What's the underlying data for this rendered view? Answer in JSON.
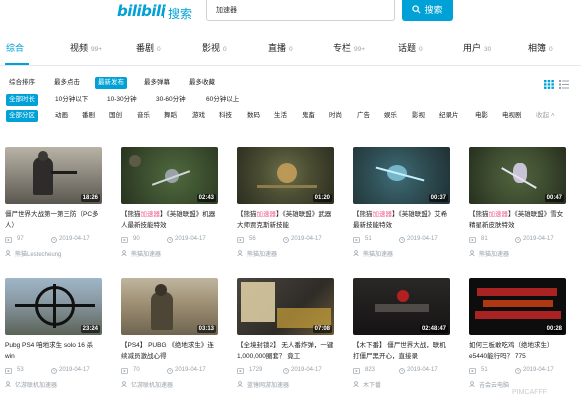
{
  "header": {
    "logo": "bilibili",
    "logo_sub": "搜索",
    "search_value": "加速器",
    "search_button": "搜索"
  },
  "tabs": [
    {
      "label": "综合",
      "count": ""
    },
    {
      "label": "视频",
      "count": "99+"
    },
    {
      "label": "番剧",
      "count": "0"
    },
    {
      "label": "影视",
      "count": "0"
    },
    {
      "label": "直播",
      "count": "0"
    },
    {
      "label": "专栏",
      "count": "99+"
    },
    {
      "label": "话题",
      "count": "0"
    },
    {
      "label": "用户",
      "count": "30"
    },
    {
      "label": "相簿",
      "count": "0"
    }
  ],
  "sort_options": [
    "综合排序",
    "最多点击",
    "最新发布",
    "最多弹幕",
    "最多收藏"
  ],
  "sort_selected": "最新发布",
  "duration_options": [
    "全部时长",
    "10分钟以下",
    "10-30分钟",
    "30-60分钟",
    "60分钟以上"
  ],
  "duration_selected": "全部时长",
  "zone_options": [
    "全部分区",
    "动画",
    "番剧",
    "国创",
    "音乐",
    "舞蹈",
    "游戏",
    "科技",
    "数码",
    "生活",
    "鬼畜",
    "时尚",
    "广告",
    "娱乐",
    "影视",
    "纪录片",
    "电影",
    "电视剧"
  ],
  "zone_selected": "全部分区",
  "zone_collapse": "收起",
  "videos": [
    {
      "duration": "18:26",
      "title_pre": "僵尸世界大战第一第三防（PC多人）",
      "title_hl": "",
      "title_post": "",
      "views": "97",
      "date": "2019-04-17",
      "uploader": "熊猫Lestecheung"
    },
    {
      "duration": "02:43",
      "title_pre": "【熊猫",
      "title_hl": "加速器",
      "title_post": "】《英雄联盟》机器人最新技能特效",
      "views": "90",
      "date": "2019-04-17",
      "uploader": "熊猫加速器"
    },
    {
      "duration": "01:20",
      "title_pre": "【熊猫",
      "title_hl": "加速器",
      "title_post": "】《英雄联盟》武器大师贾克斯新技能",
      "views": "56",
      "date": "2019-04-17",
      "uploader": "熊猫加速器"
    },
    {
      "duration": "00:37",
      "title_pre": "【熊猫",
      "title_hl": "加速器",
      "title_post": "】《英雄联盟》艾希最新技能特效",
      "views": "51",
      "date": "2019-04-17",
      "uploader": "熊猫加速器"
    },
    {
      "duration": "00:47",
      "title_pre": "【熊猫",
      "title_hl": "加速器",
      "title_post": "】《英雄联盟》雪女精星新皮肤特效",
      "views": "81",
      "date": "2019-04-17",
      "uploader": "熊猫加速器"
    },
    {
      "duration": "23:24",
      "title_pre": "Pubg PS4 咱地求生 solo 16 杀win",
      "title_hl": "",
      "title_post": "",
      "views": "53",
      "date": "2019-04-17",
      "uploader": "亿游联机加速器"
    },
    {
      "duration": "03:13",
      "title_pre": "【PS4】 PUBG 《绝地求生》连续减员激战心得",
      "title_hl": "",
      "title_post": "",
      "views": "70",
      "date": "2019-04-17",
      "uploader": "亿游联机加速器"
    },
    {
      "duration": "07:08",
      "title_pre": "【全境封锁2】 无人番炸弹，一键1,000,000圈套？ 竟工",
      "title_hl": "",
      "title_post": "",
      "views": "1729",
      "date": "2019-04-17",
      "uploader": "蓝锤网游加速器"
    },
    {
      "duration": "02:48:47",
      "title_pre": "【木下番】 僵尸世界大战，联机打僵尸黑开心，直接录",
      "title_hl": "",
      "title_post": "",
      "views": "823",
      "date": "2019-04-17",
      "uploader": "木下番"
    },
    {
      "duration": "00:28",
      "title_pre": "如何三板敢吃鸡（绝地求生）e5440能行吗？ 775",
      "title_hl": "",
      "title_post": "",
      "views": "51",
      "date": "2019-04-17",
      "uploader": "吉会云电脑"
    }
  ],
  "watermark": "PIMCAFFF"
}
